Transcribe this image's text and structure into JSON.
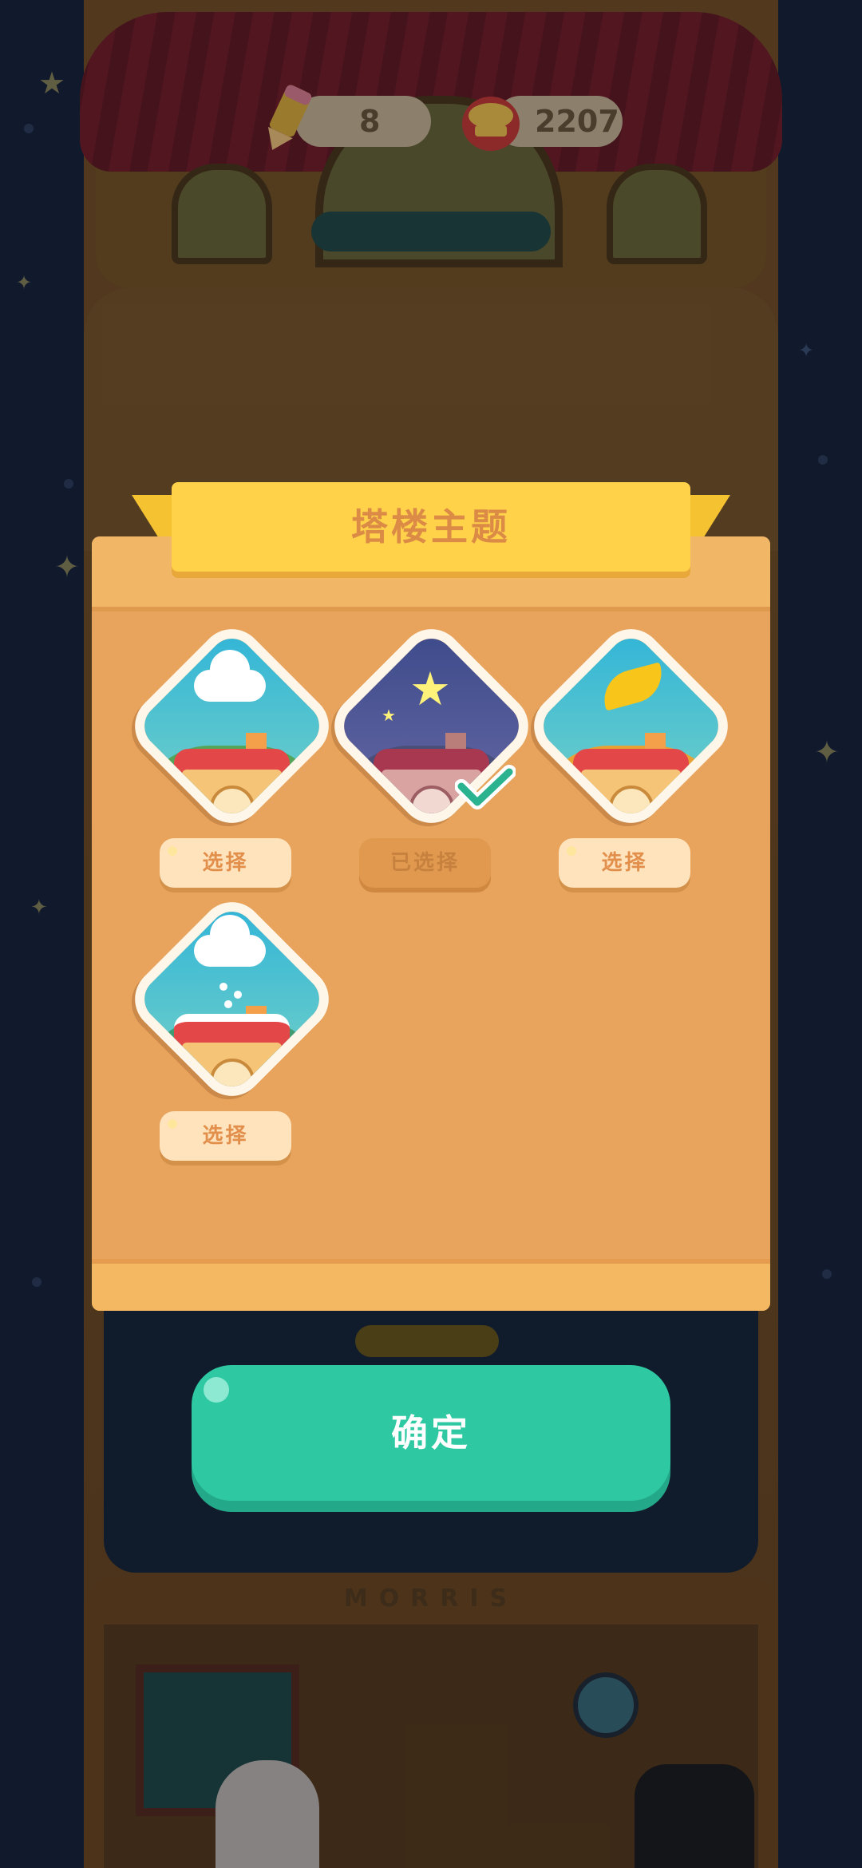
{
  "hud": {
    "pencil_icon": "pencil-icon",
    "pencil_count": "8",
    "coin_icon": "fish-can-icon",
    "coin_count": "2207"
  },
  "background": {
    "sign": "MORRIS"
  },
  "dialog": {
    "title": "塔楼主题",
    "themes": [
      {
        "icon": "cloud-house-theme-icon",
        "button": "选择",
        "selected": false
      },
      {
        "icon": "night-star-house-theme-icon",
        "button": "已选择",
        "selected": true
      },
      {
        "icon": "leaf-house-theme-icon",
        "button": "选择",
        "selected": false
      },
      {
        "icon": "snow-house-theme-icon",
        "button": "选择",
        "selected": false
      }
    ]
  },
  "confirm_label": "确定",
  "colors": {
    "panel": "#e8a45c",
    "ribbon": "#ffd24a",
    "title_text": "#dc8b46",
    "confirm": "#2ec9a2",
    "check": "#2bb38f"
  }
}
